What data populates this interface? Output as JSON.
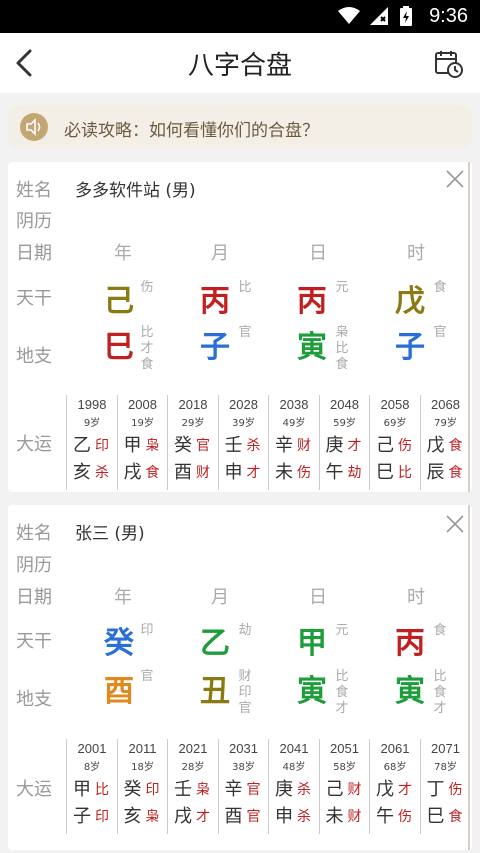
{
  "status": {
    "time": "9:36"
  },
  "header": {
    "title": "八字合盘"
  },
  "notice": {
    "text": "必读攻略：如何看懂你们的合盘？"
  },
  "labels": {
    "name": "姓名",
    "lunar": "阴历",
    "date": "日期",
    "tiangan": "天干",
    "dizhi": "地支",
    "dayun": "大运"
  },
  "columns": [
    "年",
    "月",
    "日",
    "时"
  ],
  "colors": {
    "red": "#c0201f",
    "blue": "#2a6fd6",
    "green": "#1e9e3a",
    "olive": "#8b7a12",
    "orange": "#e08a1e"
  },
  "people": [
    {
      "name": "多多软件站 (男)",
      "tiangan": [
        {
          "char": "己",
          "color": "olive",
          "ss": "伤"
        },
        {
          "char": "丙",
          "color": "red",
          "ss": "比"
        },
        {
          "char": "丙",
          "color": "red",
          "ss": "元"
        },
        {
          "char": "戊",
          "color": "olive",
          "ss": "食"
        }
      ],
      "dizhi": [
        {
          "char": "巳",
          "color": "red",
          "ss": [
            "比",
            "才",
            "食"
          ]
        },
        {
          "char": "子",
          "color": "blue",
          "ss": [
            "官"
          ]
        },
        {
          "char": "寅",
          "color": "green",
          "ss": [
            "枭",
            "比",
            "食"
          ]
        },
        {
          "char": "子",
          "color": "blue",
          "ss": [
            "官"
          ]
        }
      ],
      "dayun": [
        {
          "year": "1998",
          "age": "9岁",
          "g": "乙",
          "gs": "印",
          "z": "亥",
          "zs": "杀"
        },
        {
          "year": "2008",
          "age": "19岁",
          "g": "甲",
          "gs": "枭",
          "z": "戌",
          "zs": "食"
        },
        {
          "year": "2018",
          "age": "29岁",
          "g": "癸",
          "gs": "官",
          "z": "酉",
          "zs": "财"
        },
        {
          "year": "2028",
          "age": "39岁",
          "g": "壬",
          "gs": "杀",
          "z": "申",
          "zs": "才"
        },
        {
          "year": "2038",
          "age": "49岁",
          "g": "辛",
          "gs": "财",
          "z": "未",
          "zs": "伤"
        },
        {
          "year": "2048",
          "age": "59岁",
          "g": "庚",
          "gs": "才",
          "z": "午",
          "zs": "劫"
        },
        {
          "year": "2058",
          "age": "69岁",
          "g": "己",
          "gs": "伤",
          "z": "巳",
          "zs": "比"
        },
        {
          "year": "2068",
          "age": "79岁",
          "g": "戊",
          "gs": "食",
          "z": "辰",
          "zs": "食"
        }
      ]
    },
    {
      "name": "张三 (男)",
      "tiangan": [
        {
          "char": "癸",
          "color": "blue",
          "ss": "印"
        },
        {
          "char": "乙",
          "color": "green",
          "ss": "劫"
        },
        {
          "char": "甲",
          "color": "green",
          "ss": "元"
        },
        {
          "char": "丙",
          "color": "red",
          "ss": "食"
        }
      ],
      "dizhi": [
        {
          "char": "酉",
          "color": "orange",
          "ss": [
            "官"
          ]
        },
        {
          "char": "丑",
          "color": "olive",
          "ss": [
            "财",
            "印",
            "官"
          ]
        },
        {
          "char": "寅",
          "color": "green",
          "ss": [
            "比",
            "食",
            "才"
          ]
        },
        {
          "char": "寅",
          "color": "green",
          "ss": [
            "比",
            "食",
            "才"
          ]
        }
      ],
      "dayun": [
        {
          "year": "2001",
          "age": "8岁",
          "g": "甲",
          "gs": "比",
          "z": "子",
          "zs": "印"
        },
        {
          "year": "2011",
          "age": "18岁",
          "g": "癸",
          "gs": "印",
          "z": "亥",
          "zs": "枭"
        },
        {
          "year": "2021",
          "age": "28岁",
          "g": "壬",
          "gs": "枭",
          "z": "戌",
          "zs": "才"
        },
        {
          "year": "2031",
          "age": "38岁",
          "g": "辛",
          "gs": "官",
          "z": "酉",
          "zs": "官"
        },
        {
          "year": "2041",
          "age": "48岁",
          "g": "庚",
          "gs": "杀",
          "z": "申",
          "zs": "杀"
        },
        {
          "year": "2051",
          "age": "58岁",
          "g": "己",
          "gs": "财",
          "z": "未",
          "zs": "财"
        },
        {
          "year": "2061",
          "age": "68岁",
          "g": "戊",
          "gs": "才",
          "z": "午",
          "zs": "伤"
        },
        {
          "year": "2071",
          "age": "78岁",
          "g": "丁",
          "gs": "伤",
          "z": "巳",
          "zs": "食"
        }
      ]
    }
  ]
}
